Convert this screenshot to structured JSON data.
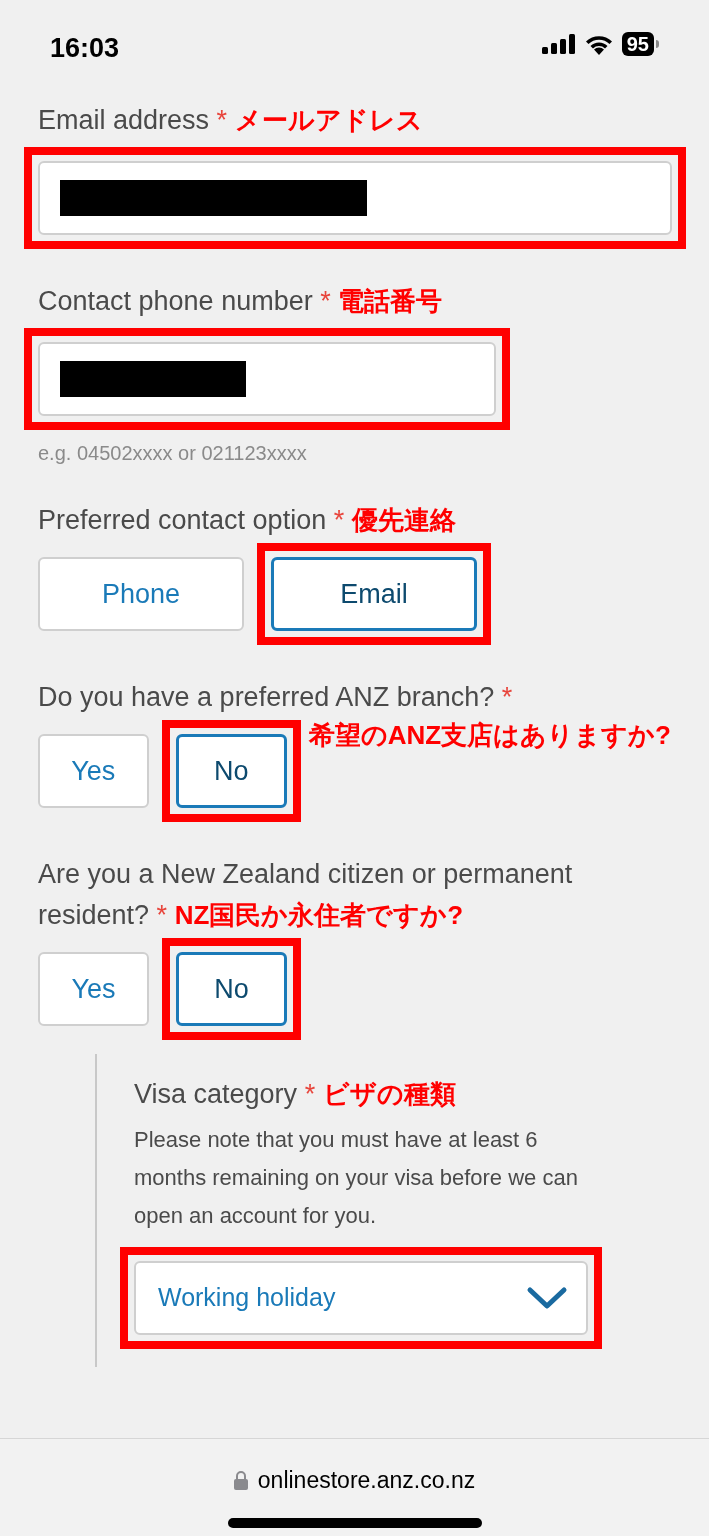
{
  "status_bar": {
    "time": "16:03",
    "battery": "95"
  },
  "fields": [
    {
      "kind": "email",
      "label": "Email address",
      "required_mark": "*",
      "annotation": {
        "kind": "label",
        "text": "メールアドレス"
      },
      "highlighted": true,
      "redacted": true
    },
    {
      "kind": "phone",
      "label": "Contact phone number",
      "required_mark": "*",
      "annotation": {
        "kind": "label",
        "text": "電話番号"
      },
      "highlighted": true,
      "redacted": true,
      "hint": "e.g. 04502xxxx or 021123xxxx"
    },
    {
      "kind": "choice",
      "label": "Preferred contact option",
      "required_mark": "*",
      "annotation": {
        "kind": "label",
        "text": "優先連絡"
      },
      "highlighted": true,
      "options": [
        {
          "label": "Phone",
          "selected": false
        },
        {
          "label": "Email",
          "selected": true
        }
      ]
    },
    {
      "kind": "choice",
      "label": "Do you have a preferred ANZ branch?",
      "required_mark": "*",
      "annotation": {
        "kind": "options",
        "text": "希望のANZ支店はありますか?"
      },
      "highlighted": true,
      "options": [
        {
          "label": "Yes",
          "selected": false
        },
        {
          "label": "No",
          "selected": true
        }
      ]
    },
    {
      "kind": "choice",
      "label": "Are you a New Zealand citizen or permanent resident?",
      "required_mark": "*",
      "annotation": {
        "kind": "label",
        "text": "NZ国民か永住者ですか?"
      },
      "highlighted": true,
      "options": [
        {
          "label": "Yes",
          "selected": false
        },
        {
          "label": "No",
          "selected": true
        }
      ]
    },
    {
      "kind": "select",
      "nested": true,
      "label": "Visa category",
      "required_mark": "*",
      "annotation": {
        "kind": "label",
        "text": "ビザの種類"
      },
      "highlighted": true,
      "help": "Please note that you must have at least 6 months remaining on your visa before we can open an account for you.",
      "value": "Working holiday"
    }
  ],
  "address_bar": {
    "url": "onlinestore.anz.co.nz"
  }
}
